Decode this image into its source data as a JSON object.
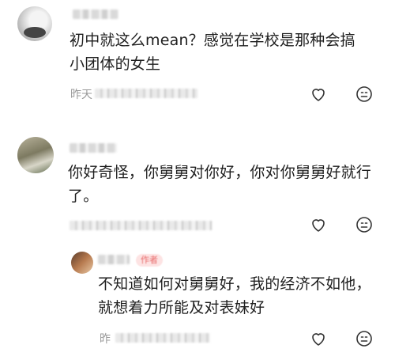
{
  "comments": [
    {
      "text": "初中就这么mean？感觉在学校是那种会搞小团体的女生",
      "meta_prefix": "昨天",
      "like_icon": "heart-outline-icon",
      "reply_icon": "emoji-face-icon"
    },
    {
      "text": "你好奇怪，你舅舅对你好，你对你舅舅好就行了。",
      "meta_prefix": "",
      "like_icon": "heart-outline-icon",
      "reply_icon": "emoji-face-icon"
    },
    {
      "text": "不知道如何对舅舅好，我的经济不如他，就想着力所能及对表妹好",
      "meta_prefix": "昨",
      "author_tag": "作者",
      "like_icon": "heart-outline-icon",
      "reply_icon": "emoji-face-icon"
    }
  ]
}
